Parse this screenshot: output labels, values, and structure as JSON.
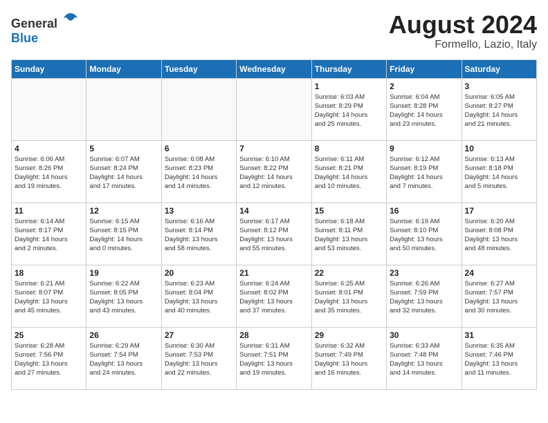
{
  "header": {
    "logo_general": "General",
    "logo_blue": "Blue",
    "month_year": "August 2024",
    "location": "Formello, Lazio, Italy"
  },
  "weekdays": [
    "Sunday",
    "Monday",
    "Tuesday",
    "Wednesday",
    "Thursday",
    "Friday",
    "Saturday"
  ],
  "weeks": [
    [
      {
        "day": "",
        "info": ""
      },
      {
        "day": "",
        "info": ""
      },
      {
        "day": "",
        "info": ""
      },
      {
        "day": "",
        "info": ""
      },
      {
        "day": "1",
        "info": "Sunrise: 6:03 AM\nSunset: 8:29 PM\nDaylight: 14 hours\nand 25 minutes."
      },
      {
        "day": "2",
        "info": "Sunrise: 6:04 AM\nSunset: 8:28 PM\nDaylight: 14 hours\nand 23 minutes."
      },
      {
        "day": "3",
        "info": "Sunrise: 6:05 AM\nSunset: 8:27 PM\nDaylight: 14 hours\nand 21 minutes."
      }
    ],
    [
      {
        "day": "4",
        "info": "Sunrise: 6:06 AM\nSunset: 8:26 PM\nDaylight: 14 hours\nand 19 minutes."
      },
      {
        "day": "5",
        "info": "Sunrise: 6:07 AM\nSunset: 8:24 PM\nDaylight: 14 hours\nand 17 minutes."
      },
      {
        "day": "6",
        "info": "Sunrise: 6:08 AM\nSunset: 8:23 PM\nDaylight: 14 hours\nand 14 minutes."
      },
      {
        "day": "7",
        "info": "Sunrise: 6:10 AM\nSunset: 8:22 PM\nDaylight: 14 hours\nand 12 minutes."
      },
      {
        "day": "8",
        "info": "Sunrise: 6:11 AM\nSunset: 8:21 PM\nDaylight: 14 hours\nand 10 minutes."
      },
      {
        "day": "9",
        "info": "Sunrise: 6:12 AM\nSunset: 8:19 PM\nDaylight: 14 hours\nand 7 minutes."
      },
      {
        "day": "10",
        "info": "Sunrise: 6:13 AM\nSunset: 8:18 PM\nDaylight: 14 hours\nand 5 minutes."
      }
    ],
    [
      {
        "day": "11",
        "info": "Sunrise: 6:14 AM\nSunset: 8:17 PM\nDaylight: 14 hours\nand 2 minutes."
      },
      {
        "day": "12",
        "info": "Sunrise: 6:15 AM\nSunset: 8:15 PM\nDaylight: 14 hours\nand 0 minutes."
      },
      {
        "day": "13",
        "info": "Sunrise: 6:16 AM\nSunset: 8:14 PM\nDaylight: 13 hours\nand 58 minutes."
      },
      {
        "day": "14",
        "info": "Sunrise: 6:17 AM\nSunset: 8:12 PM\nDaylight: 13 hours\nand 55 minutes."
      },
      {
        "day": "15",
        "info": "Sunrise: 6:18 AM\nSunset: 8:11 PM\nDaylight: 13 hours\nand 53 minutes."
      },
      {
        "day": "16",
        "info": "Sunrise: 6:19 AM\nSunset: 8:10 PM\nDaylight: 13 hours\nand 50 minutes."
      },
      {
        "day": "17",
        "info": "Sunrise: 6:20 AM\nSunset: 8:08 PM\nDaylight: 13 hours\nand 48 minutes."
      }
    ],
    [
      {
        "day": "18",
        "info": "Sunrise: 6:21 AM\nSunset: 8:07 PM\nDaylight: 13 hours\nand 45 minutes."
      },
      {
        "day": "19",
        "info": "Sunrise: 6:22 AM\nSunset: 8:05 PM\nDaylight: 13 hours\nand 43 minutes."
      },
      {
        "day": "20",
        "info": "Sunrise: 6:23 AM\nSunset: 8:04 PM\nDaylight: 13 hours\nand 40 minutes."
      },
      {
        "day": "21",
        "info": "Sunrise: 6:24 AM\nSunset: 8:02 PM\nDaylight: 13 hours\nand 37 minutes."
      },
      {
        "day": "22",
        "info": "Sunrise: 6:25 AM\nSunset: 8:01 PM\nDaylight: 13 hours\nand 35 minutes."
      },
      {
        "day": "23",
        "info": "Sunrise: 6:26 AM\nSunset: 7:59 PM\nDaylight: 13 hours\nand 32 minutes."
      },
      {
        "day": "24",
        "info": "Sunrise: 6:27 AM\nSunset: 7:57 PM\nDaylight: 13 hours\nand 30 minutes."
      }
    ],
    [
      {
        "day": "25",
        "info": "Sunrise: 6:28 AM\nSunset: 7:56 PM\nDaylight: 13 hours\nand 27 minutes."
      },
      {
        "day": "26",
        "info": "Sunrise: 6:29 AM\nSunset: 7:54 PM\nDaylight: 13 hours\nand 24 minutes."
      },
      {
        "day": "27",
        "info": "Sunrise: 6:30 AM\nSunset: 7:53 PM\nDaylight: 13 hours\nand 22 minutes."
      },
      {
        "day": "28",
        "info": "Sunrise: 6:31 AM\nSunset: 7:51 PM\nDaylight: 13 hours\nand 19 minutes."
      },
      {
        "day": "29",
        "info": "Sunrise: 6:32 AM\nSunset: 7:49 PM\nDaylight: 13 hours\nand 16 minutes."
      },
      {
        "day": "30",
        "info": "Sunrise: 6:33 AM\nSunset: 7:48 PM\nDaylight: 13 hours\nand 14 minutes."
      },
      {
        "day": "31",
        "info": "Sunrise: 6:35 AM\nSunset: 7:46 PM\nDaylight: 13 hours\nand 11 minutes."
      }
    ]
  ]
}
